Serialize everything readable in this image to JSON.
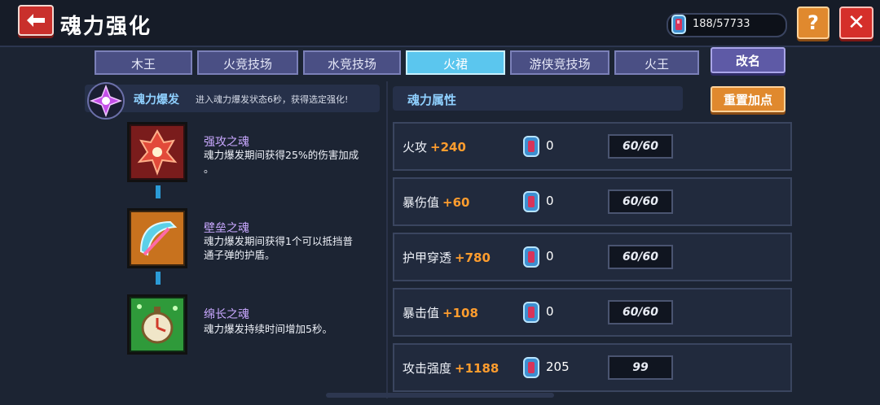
{
  "header": {
    "title": "魂力强化",
    "currency_value": "188/57733",
    "help_label": "?",
    "close_label": "✕"
  },
  "tabs": [
    {
      "label": "木王"
    },
    {
      "label": "火竞技场"
    },
    {
      "label": "水竞技场"
    },
    {
      "label": "火裙",
      "active": true
    },
    {
      "label": "游侠竞技场"
    },
    {
      "label": "火王"
    }
  ],
  "rename_label": "改名",
  "burst": {
    "title": "魂力爆发",
    "description": "进入魂力爆发状态6秒，获得选定强化!"
  },
  "souls": [
    {
      "name": "强攻之魂",
      "desc_line1": "魂力爆发期间获得25%的伤害加成",
      "desc_line2": "。",
      "color": "#d0322a"
    },
    {
      "name": "壁垒之魂",
      "desc_line1": "魂力爆发期间获得1个可以抵挡普",
      "desc_line2": "通子弹的护盾。",
      "color": "#e0892e"
    },
    {
      "name": "绵长之魂",
      "desc_line1": "魂力爆发持续时间增加5秒。",
      "desc_line2": "",
      "color": "#2fa83c"
    }
  ],
  "attributes": {
    "header": "魂力属性",
    "reset_label": "重置加点",
    "rows": [
      {
        "name": "火攻",
        "bonus": "+240",
        "count": "0",
        "level": "60/60"
      },
      {
        "name": "暴伤值",
        "bonus": "+60",
        "count": "0",
        "level": "60/60"
      },
      {
        "name": "护甲穿透",
        "bonus": "+780",
        "count": "0",
        "level": "60/60"
      },
      {
        "name": "暴击值",
        "bonus": "+108",
        "count": "0",
        "level": "60/60"
      },
      {
        "name": "攻击强度",
        "bonus": "+1188",
        "count": "205",
        "level": "99"
      }
    ]
  }
}
